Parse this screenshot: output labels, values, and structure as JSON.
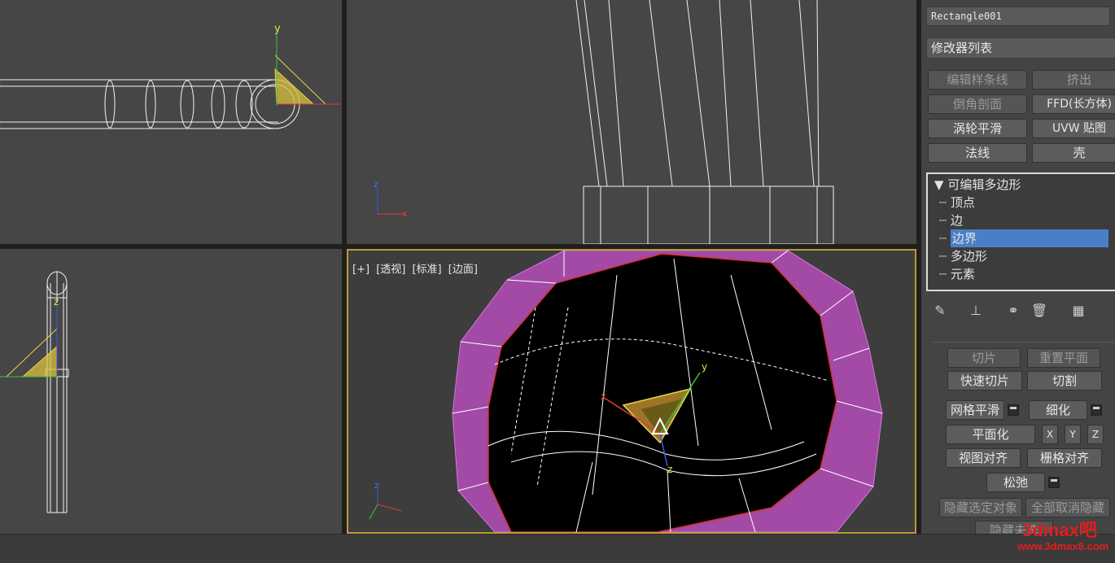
{
  "viewport_label": {
    "plus": "[+]",
    "view": "[透视]",
    "shading": "[标准]",
    "mode": "[边面]"
  },
  "axes": {
    "x": "x",
    "y": "y",
    "z": "z"
  },
  "panel": {
    "object_name": "Rectangle001",
    "modifier_list": "修改器列表",
    "modifier_buttons": [
      "编辑样条线",
      "挤出",
      "倒角剖面",
      "FFD(长方体)",
      "涡轮平滑",
      "UVW 贴图",
      "法线",
      "壳"
    ],
    "stack": {
      "root": "可编辑多边形",
      "items": [
        "顶点",
        "边",
        "边界",
        "多边形",
        "元素"
      ],
      "selected_index": 2
    },
    "edit_geometry": {
      "slice": "切片",
      "reset_plane": "重置平面",
      "quick_slice": "快速切片",
      "cut": "切割",
      "meshsmooth": "网格平滑",
      "tessellate": "细化",
      "make_planar": "平面化",
      "x": "X",
      "y": "Y",
      "z": "Z",
      "view_align": "视图对齐",
      "grid_align": "栅格对齐",
      "relax": "松弛",
      "hide_selected": "隐藏选定对象",
      "unhide_all": "全部取消隐藏",
      "hide_unselected": "隐藏未选"
    }
  },
  "watermark": {
    "brand": "3dmax吧",
    "url": "www.3dmax8.com"
  },
  "colors": {
    "viewport": "#464646",
    "active_border": "#b99a3c",
    "selection": "#4a7fc8",
    "magenta": "#a24aa6",
    "gizmo": "#e0c94a"
  }
}
